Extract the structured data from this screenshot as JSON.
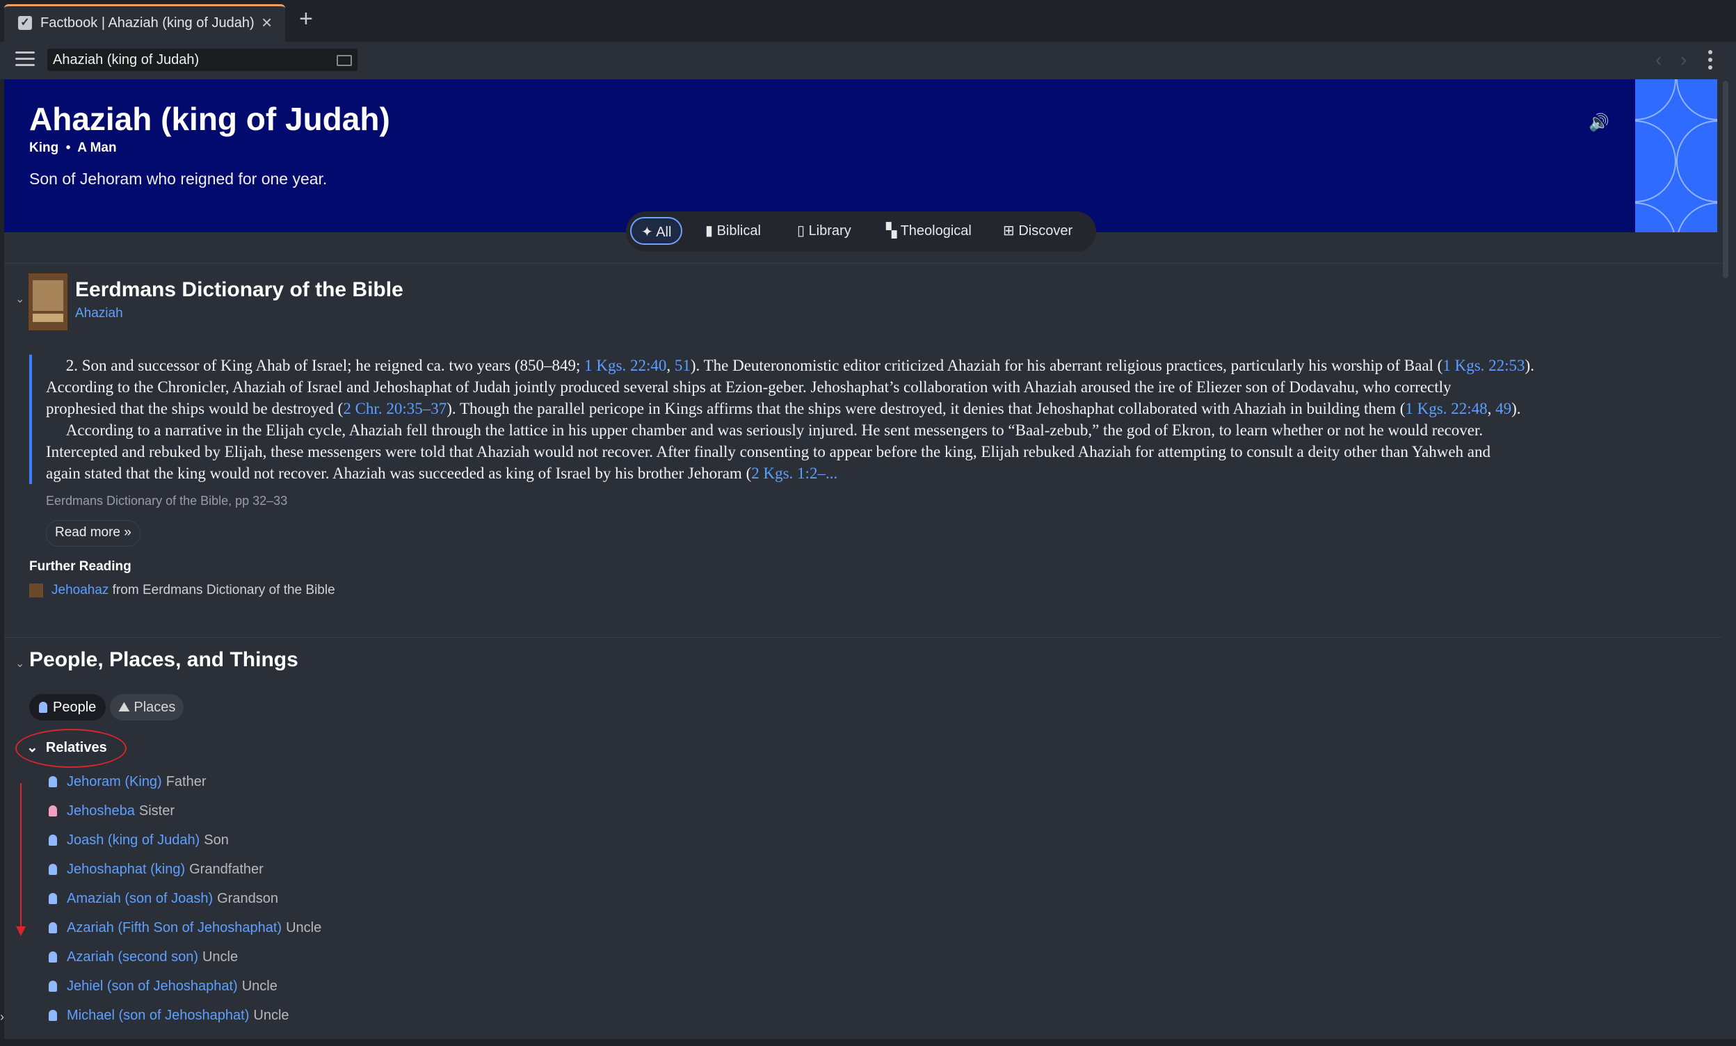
{
  "tab": {
    "title": "Factbook | Ahaziah (king of Judah)",
    "favicon": "checkbox-icon"
  },
  "toolbar": {
    "address": "Ahaziah (king of Judah)"
  },
  "header": {
    "title": "Ahaziah (king of Judah)",
    "type": "King",
    "category": "A Man",
    "description": "Son of Jehoram who reigned for one year."
  },
  "filters": [
    {
      "label": "All",
      "icon": "sparkle-icon",
      "active": true
    },
    {
      "label": "Biblical",
      "icon": "bookmark-icon"
    },
    {
      "label": "Library",
      "icon": "book-icon"
    },
    {
      "label": "Theological",
      "icon": "blocks-icon"
    },
    {
      "label": "Discover",
      "icon": "discover-icon"
    }
  ],
  "article": {
    "book_title": "Eerdmans Dictionary of the Bible",
    "book_link": "Ahaziah",
    "paragraph1": {
      "line1_pre": "2. Son and successor of King Ahab of Israel; he reigned ca. two years (850–849; ",
      "line1_ref1": "1 Kgs. 22:40",
      "line1_mid": ", ",
      "line1_ref2": "51",
      "line1_post": "). The Deuteronomistic editor criticized Ahaziah for his aberrant religious practices, particularly his worship of Baal (",
      "line1_ref3": "1 Kgs. 22:53",
      "line1_end": ").",
      "line2": "According to the Chronicler, Ahaziah of Israel and Jehoshaphat of Judah jointly produced several ships at Ezion-geber. Jehoshaphat’s collaboration with Ahaziah aroused the ire of Eliezer son of Dodavahu, who correctly",
      "line3_pre": "prophesied that the ships would be destroyed (",
      "line3_ref1": "2 Chr. 20:35–37",
      "line3_mid": "). Though the parallel pericope in Kings affirms that the ships were destroyed, it denies that Jehoshaphat collaborated with Ahaziah in building them (",
      "line3_ref2": "1 Kgs. 22:48",
      "line3_sep": ", ",
      "line3_ref3": "49",
      "line3_end": ")."
    },
    "paragraph2": {
      "line1": "According to a narrative in the Elijah cycle, Ahaziah fell through the lattice in his upper chamber and was seriously injured. He sent messengers to “Baal-zebub,” the god of Ekron, to learn whether or not he would recover.",
      "line2": "Intercepted and rebuked by Elijah, these messengers were told that Ahaziah would not recover. After finally consenting to appear before the king, Elijah rebuked Ahaziah for attempting to consult a deity other than Yahweh and",
      "line3_pre": "again stated that the king would not recover. Ahaziah was succeeded as king of Israel by his brother Jehoram (",
      "line3_ref": "2 Kgs. 1:2–..."
    },
    "source": "Eerdmans Dictionary of the Bible, pp 32–33",
    "read_more": "Read more »",
    "further_reading_title": "Further Reading",
    "further_link": "Jehoahaz",
    "further_suffix": " from Eerdmans Dictionary of the Bible"
  },
  "people": {
    "title": "People, Places, and Things",
    "pill_people": "People",
    "pill_places": "Places",
    "relatives_label": "Relatives",
    "relatives": [
      {
        "name": "Jehoram (King)",
        "role": "Father",
        "gender": "male"
      },
      {
        "name": "Jehosheba",
        "role": "Sister",
        "gender": "female"
      },
      {
        "name": "Joash (king of Judah)",
        "role": "Son",
        "gender": "male"
      },
      {
        "name": "Jehoshaphat (king)",
        "role": "Grandfather",
        "gender": "male"
      },
      {
        "name": "Amaziah (son of Joash)",
        "role": "Grandson",
        "gender": "male"
      },
      {
        "name": "Azariah (Fifth Son of Jehoshaphat)",
        "role": "Uncle",
        "gender": "male"
      },
      {
        "name": "Azariah (second son)",
        "role": "Uncle",
        "gender": "male"
      },
      {
        "name": "Jehiel (son of Jehoshaphat)",
        "role": "Uncle",
        "gender": "male"
      },
      {
        "name": "Michael (son of Jehoshaphat)",
        "role": "Uncle",
        "gender": "male"
      }
    ]
  },
  "colors": {
    "header_bg": "#020a6e",
    "link": "#5da0ff",
    "accent": "#3d7dff",
    "annotation": "#d8262a"
  }
}
